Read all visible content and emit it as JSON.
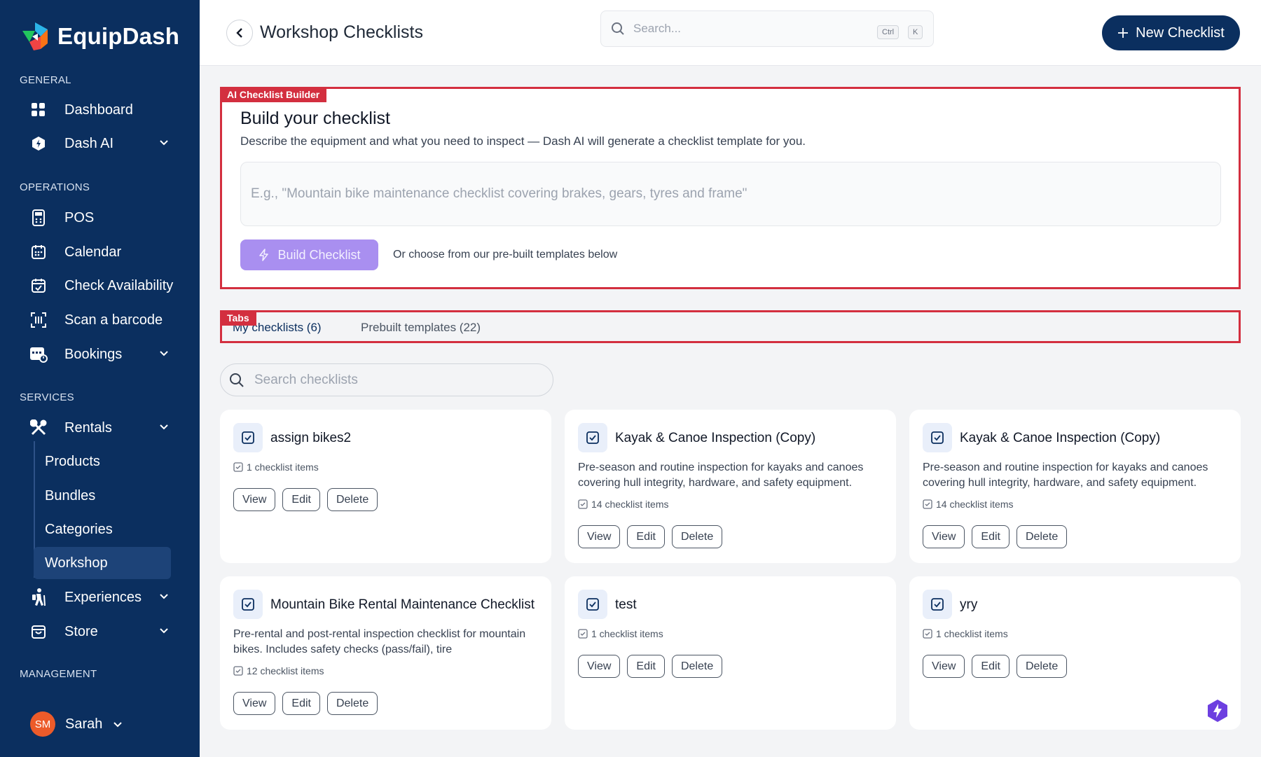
{
  "sidebar": {
    "brand": "EquipDash",
    "sections": {
      "general": "GENERAL",
      "operations": "OPERATIONS",
      "services": "SERVICES",
      "management": "MANAGEMENT"
    },
    "items": {
      "dashboard": "Dashboard",
      "dash_ai": "Dash AI",
      "pos": "POS",
      "calendar": "Calendar",
      "check_availability": "Check Availability",
      "scan_barcode": "Scan a barcode",
      "bookings": "Bookings",
      "rentals": "Rentals",
      "products": "Products",
      "bundles": "Bundles",
      "categories": "Categories",
      "workshop": "Workshop",
      "experiences": "Experiences",
      "store": "Store"
    },
    "user": {
      "initials": "SM",
      "name": "Sarah"
    }
  },
  "header": {
    "title": "Workshop Checklists",
    "search_placeholder": "Search...",
    "shortcut_keys": [
      "Ctrl",
      "K"
    ],
    "new_button": "New Checklist"
  },
  "ai_builder": {
    "tag": "AI Checklist Builder",
    "title": "Build your checklist",
    "description": "Describe the equipment and what you need to inspect — Dash AI will generate a checklist template for you.",
    "input_placeholder": "E.g., \"Mountain bike maintenance checklist covering brakes, gears, tyres and frame\"",
    "build_button": "Build Checklist",
    "or_text": "Or choose from our pre-built templates below"
  },
  "tabs": {
    "tag": "Tabs",
    "items": [
      "My checklists (6)",
      "Prebuilt templates (22)"
    ]
  },
  "checklist_search_placeholder": "Search checklists",
  "cards": [
    {
      "title": "assign bikes2",
      "description": "",
      "count": "1 checklist items"
    },
    {
      "title": "Kayak & Canoe Inspection (Copy)",
      "description": "Pre-season and routine inspection for kayaks and canoes covering hull integrity, hardware, and safety equipment.",
      "count": "14 checklist items"
    },
    {
      "title": "Kayak & Canoe Inspection (Copy)",
      "description": "Pre-season and routine inspection for kayaks and canoes covering hull integrity, hardware, and safety equipment.",
      "count": "14 checklist items"
    },
    {
      "title": "Mountain Bike Rental Maintenance Checklist",
      "description": "Pre-rental and post-rental inspection checklist for mountain bikes. Includes safety checks (pass/fail), tire",
      "count": "12 checklist items"
    },
    {
      "title": "test",
      "description": "",
      "count": "1 checklist items"
    },
    {
      "title": "yry",
      "description": "",
      "count": "1 checklist items"
    }
  ],
  "card_buttons": {
    "view": "View",
    "edit": "Edit",
    "delete": "Delete"
  },
  "colors": {
    "sidebar": "#0b2f5f",
    "accent": "#0b2f5f",
    "highlight": "#d32f3f",
    "build_button": "#a98ff0"
  }
}
